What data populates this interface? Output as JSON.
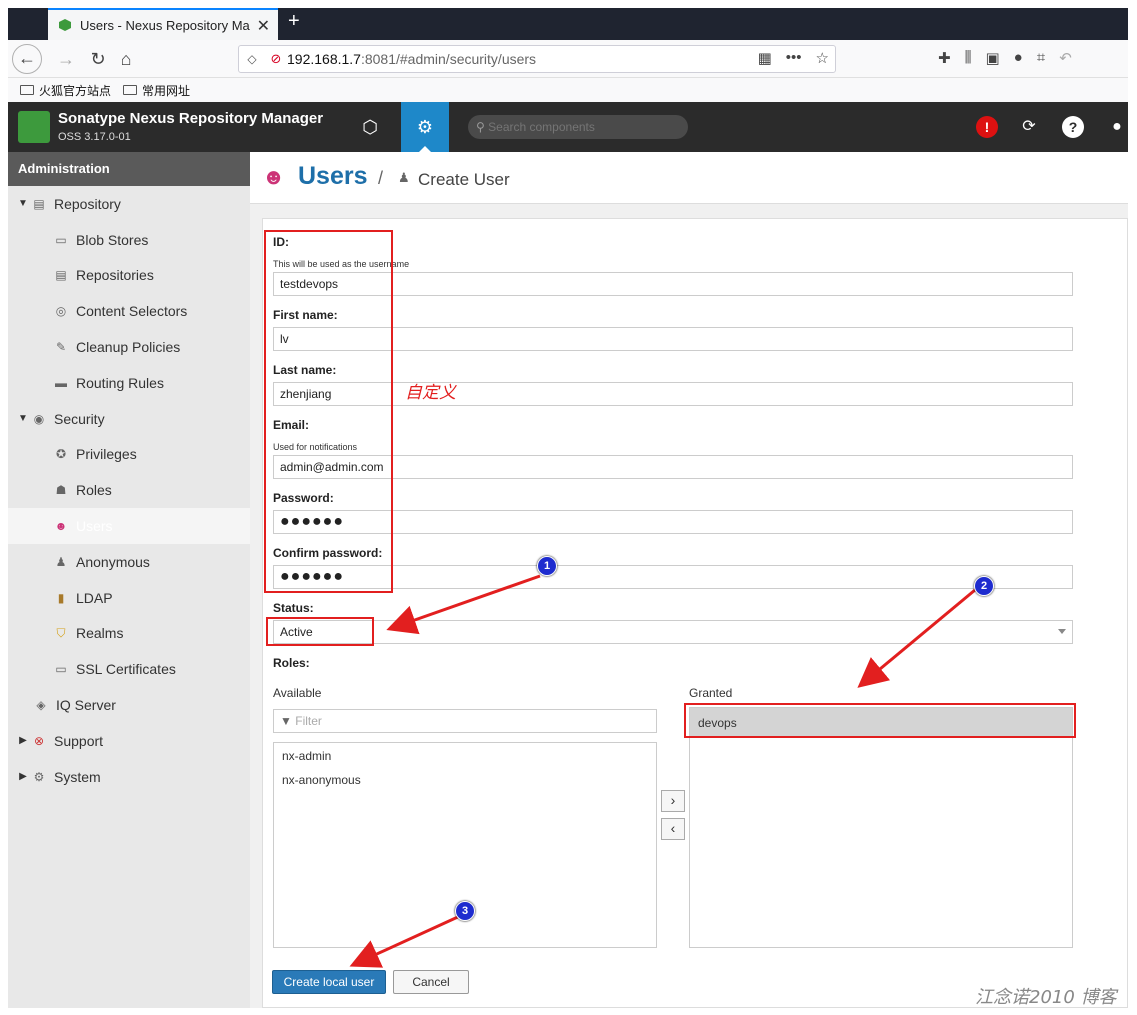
{
  "browser": {
    "tab_title": "Users - Nexus Repository Ma",
    "url_host": "192.168.1.7",
    "url_rest": ":8081/#admin/security/users",
    "bookmarks": [
      "火狐官方站点",
      "常用网址"
    ]
  },
  "app": {
    "name": "Sonatype Nexus Repository Manager",
    "version": "OSS 3.17.0-01",
    "search_placeholder": "Search components"
  },
  "sidebar": {
    "header": "Administration",
    "items": [
      {
        "label": "Repository",
        "icon": "database-icon"
      },
      {
        "label": "Blob Stores",
        "icon": "server-icon"
      },
      {
        "label": "Repositories",
        "icon": "database-icon"
      },
      {
        "label": "Content Selectors",
        "icon": "selector-icon"
      },
      {
        "label": "Cleanup Policies",
        "icon": "brush-icon"
      },
      {
        "label": "Routing Rules",
        "icon": "routing-icon"
      },
      {
        "label": "Security",
        "icon": "eye-icon"
      },
      {
        "label": "Privileges",
        "icon": "badge-icon"
      },
      {
        "label": "Roles",
        "icon": "role-icon"
      },
      {
        "label": "Users",
        "icon": "users-icon"
      },
      {
        "label": "Anonymous",
        "icon": "person-icon"
      },
      {
        "label": "LDAP",
        "icon": "book-icon"
      },
      {
        "label": "Realms",
        "icon": "shield-icon"
      },
      {
        "label": "SSL Certificates",
        "icon": "certificate-icon"
      },
      {
        "label": "IQ Server",
        "icon": "iq-icon"
      },
      {
        "label": "Support",
        "icon": "support-icon"
      },
      {
        "label": "System",
        "icon": "gear-icon"
      }
    ]
  },
  "breadcrumb": {
    "title": "Users",
    "separator": "/",
    "current": "Create User"
  },
  "form": {
    "id_label": "ID:",
    "id_help": "This will be used as the username",
    "id_value": "testdevops",
    "first_label": "First name:",
    "first_value": "lv",
    "last_label": "Last name:",
    "last_value": "zhenjiang",
    "email_label": "Email:",
    "email_help": "Used for notifications",
    "email_value": "admin@admin.com",
    "password_label": "Password:",
    "password_value": "●●●●●●",
    "confirm_label": "Confirm password:",
    "confirm_value": "●●●●●●",
    "status_label": "Status:",
    "status_value": "Active",
    "roles_label": "Roles:",
    "available_label": "Available",
    "granted_label": "Granted",
    "filter_placeholder": "Filter",
    "available_roles": [
      "nx-admin",
      "nx-anonymous"
    ],
    "granted_roles": [
      "devops"
    ],
    "move_right": "›",
    "move_left": "‹",
    "create_button": "Create local user",
    "cancel_button": "Cancel"
  },
  "annotations": {
    "custom_text": "自定义",
    "badge1": "1",
    "badge2": "2",
    "badge3": "3",
    "watermark": "江念诺2010 博客",
    "accent_color": "#e21f1f"
  }
}
